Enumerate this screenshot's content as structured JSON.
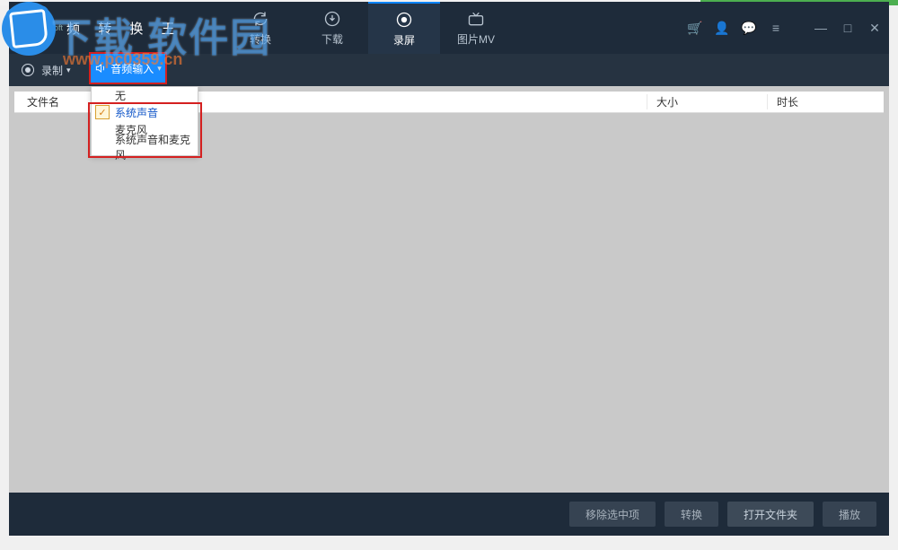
{
  "brand": {
    "small": "apowersoft",
    "title": "频 转 换 王"
  },
  "tabs": [
    {
      "id": "convert",
      "label": "转换"
    },
    {
      "id": "download",
      "label": "下载"
    },
    {
      "id": "record",
      "label": "录屏"
    },
    {
      "id": "mv",
      "label": "图片MV"
    }
  ],
  "active_tab": "record",
  "toolbar": {
    "record_label": "录制",
    "audio_input_label": "音频输入"
  },
  "audio_menu": {
    "items": [
      {
        "label": "无",
        "selected": false
      },
      {
        "label": "系统声音",
        "selected": true
      },
      {
        "label": "麦克风",
        "selected": false
      },
      {
        "label": "系统声音和麦克风",
        "selected": false
      }
    ]
  },
  "columns": {
    "name": "文件名",
    "size": "大小",
    "duration": "时长"
  },
  "footer": {
    "remove": "移除选中项",
    "convert": "转换",
    "open_folder": "打开文件夹",
    "play": "播放"
  },
  "watermark": {
    "text": "下载 软件园",
    "url": "www.pc0359.cn"
  }
}
